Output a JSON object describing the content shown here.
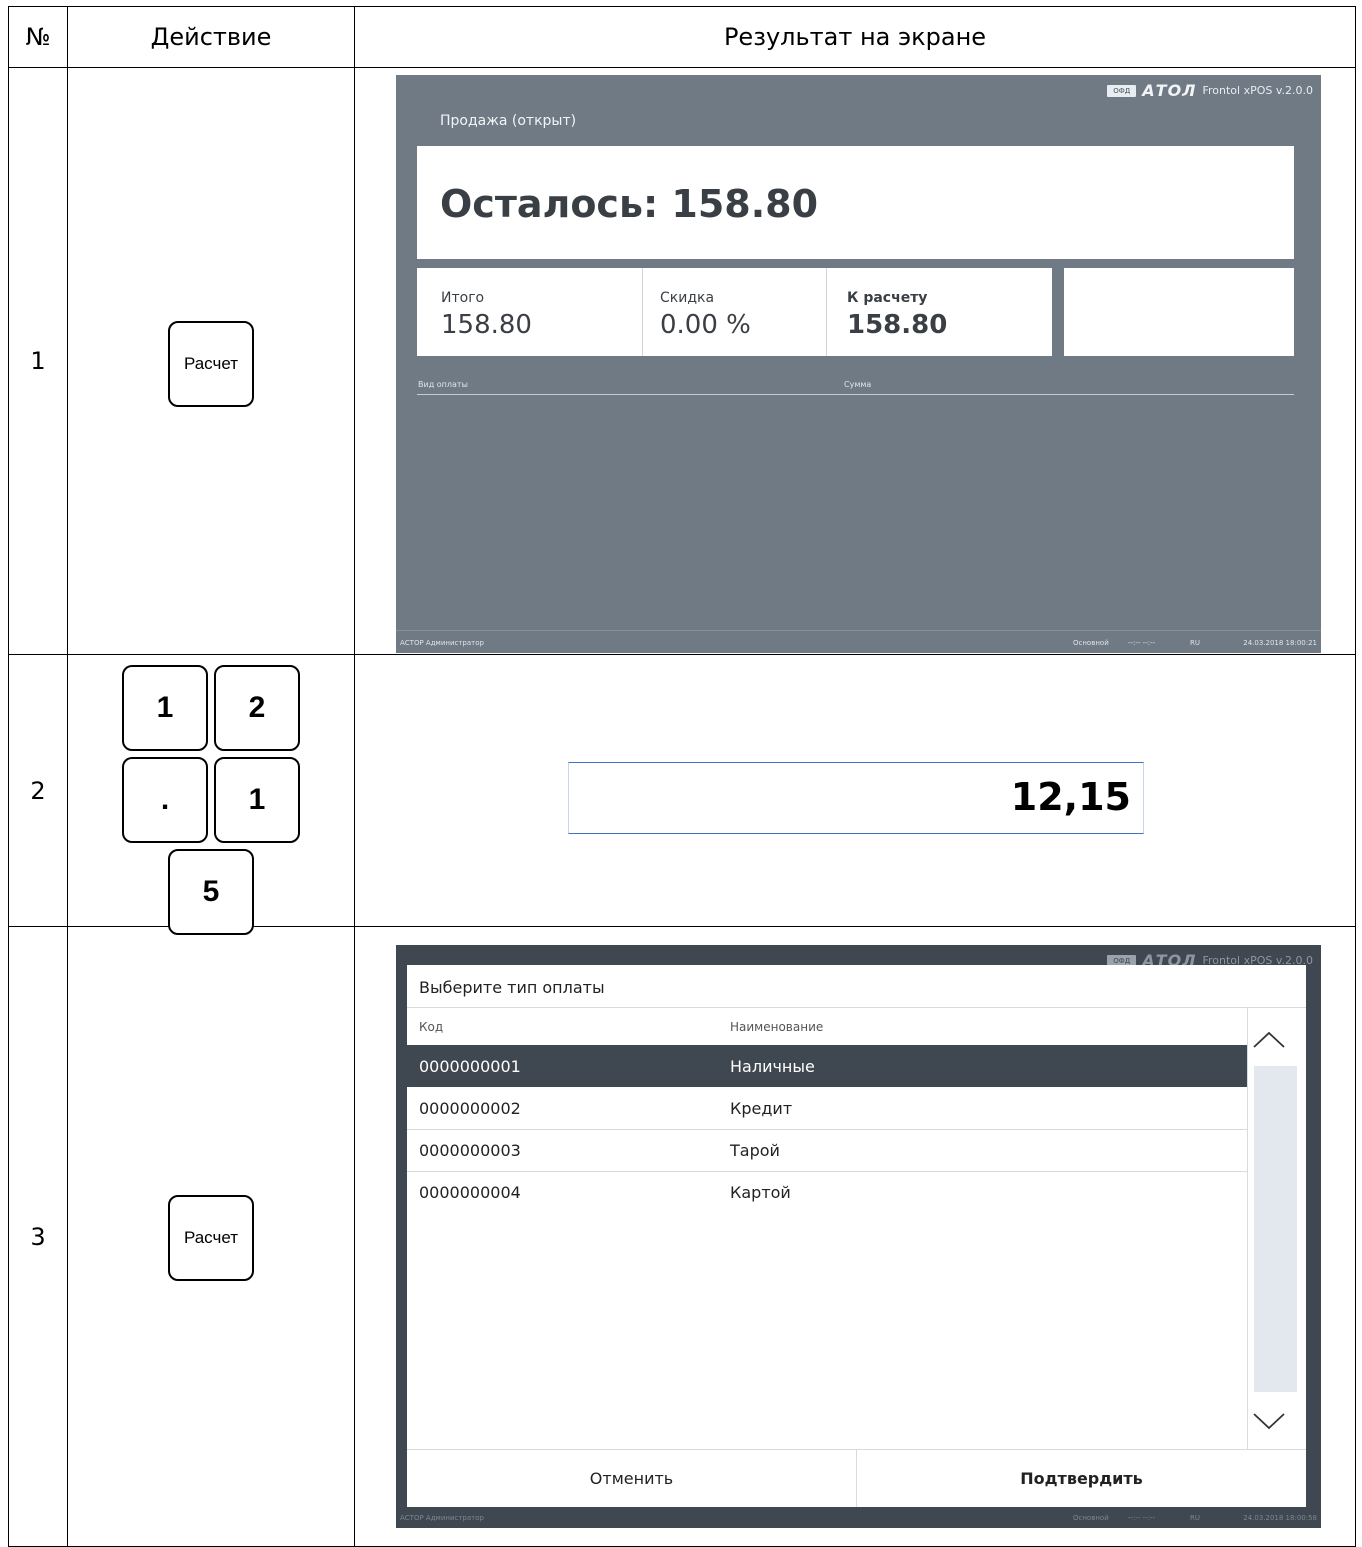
{
  "headers": {
    "num": "№",
    "action": "Действие",
    "result": "Результат на экране"
  },
  "rows": [
    {
      "num": "1",
      "key_label": "Расчет"
    },
    {
      "num": "2",
      "keys": [
        "1",
        "2",
        ".",
        "1",
        "5"
      ]
    },
    {
      "num": "3",
      "key_label": "Расчет"
    }
  ],
  "screen1": {
    "ofd": "ОФД",
    "brand": "АТОЛ",
    "version": "Frontol xPOS v.2.0.0",
    "status": "Продажа (открыт)",
    "remaining": "Осталось: 158.80",
    "total_label": "Итого",
    "total_value": "158.80",
    "discount_label": "Скидка",
    "discount_value": "0.00 %",
    "topay_label": "К расчету",
    "topay_value": "158.80",
    "col_paytype": "Вид оплаты",
    "col_sum": "Сумма",
    "footer_left": "АСТОР  Администратор",
    "footer_mode": "Основной",
    "footer_dashes": "--:--   --:--",
    "footer_lang": "RU",
    "footer_datetime": "24.03.2018 18:00:21"
  },
  "entry": {
    "value": "12,15"
  },
  "screen3": {
    "ofd": "ОФД",
    "brand": "АТОЛ",
    "version": "Frontol xPOS v.2.0.0",
    "dialog_title": "Выберите тип оплаты",
    "col_code": "Код",
    "col_name": "Наименование",
    "items": [
      {
        "code": "0000000001",
        "name": "Наличные",
        "selected": true
      },
      {
        "code": "0000000002",
        "name": "Кредит",
        "selected": false
      },
      {
        "code": "0000000003",
        "name": "Тарой",
        "selected": false
      },
      {
        "code": "0000000004",
        "name": "Картой",
        "selected": false
      }
    ],
    "cancel": "Отменить",
    "confirm": "Подтвердить",
    "footer_left": "АСТОР  Администратор",
    "footer_mode": "Основной",
    "footer_dashes": "--:--   --:--",
    "footer_lang": "RU",
    "footer_datetime": "24.03.2018 18:00:58"
  }
}
